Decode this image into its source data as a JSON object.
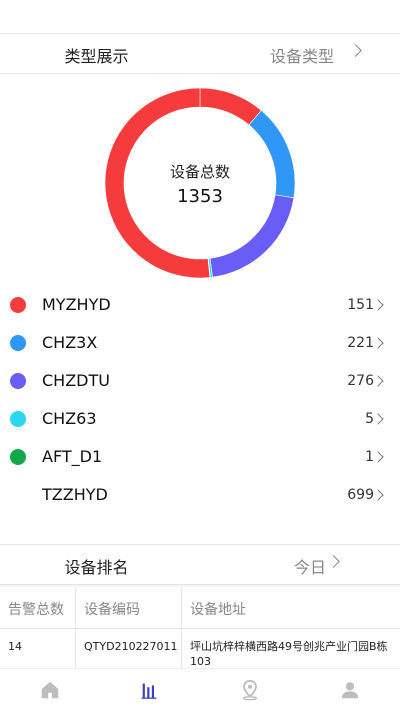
{
  "types_section": {
    "title": "类型展示",
    "link_label": "设备类型"
  },
  "donut": {
    "center_label": "设备总数",
    "total": "1353"
  },
  "legend": [
    {
      "name": "MYZHYD",
      "count": "151",
      "value": 151,
      "color": "#f53b3b"
    },
    {
      "name": "CHZ3X",
      "count": "221",
      "value": 221,
      "color": "#2f97f5"
    },
    {
      "name": "CHZDTU",
      "count": "276",
      "value": 276,
      "color": "#6a5cf7"
    },
    {
      "name": "CHZ63",
      "count": "5",
      "value": 5,
      "color": "#2ad6f0"
    },
    {
      "name": "AFT_D1",
      "count": "1",
      "value": 1,
      "color": "#10a84a"
    },
    {
      "name": "TZZHYD",
      "count": "699",
      "value": 699,
      "color": "#f53b3b"
    }
  ],
  "ranking_section": {
    "title": "设备排名",
    "link_label": "今日"
  },
  "table": {
    "headers": [
      "告警总数",
      "设备编码",
      "设备地址"
    ],
    "rows": [
      [
        "14",
        "QTYD210227011",
        "坪山坑梓梓横西路49号创兆产业门园B栋103"
      ]
    ]
  },
  "tabbar": [
    "home-icon",
    "chart-icon",
    "location-icon",
    "user-icon"
  ]
}
